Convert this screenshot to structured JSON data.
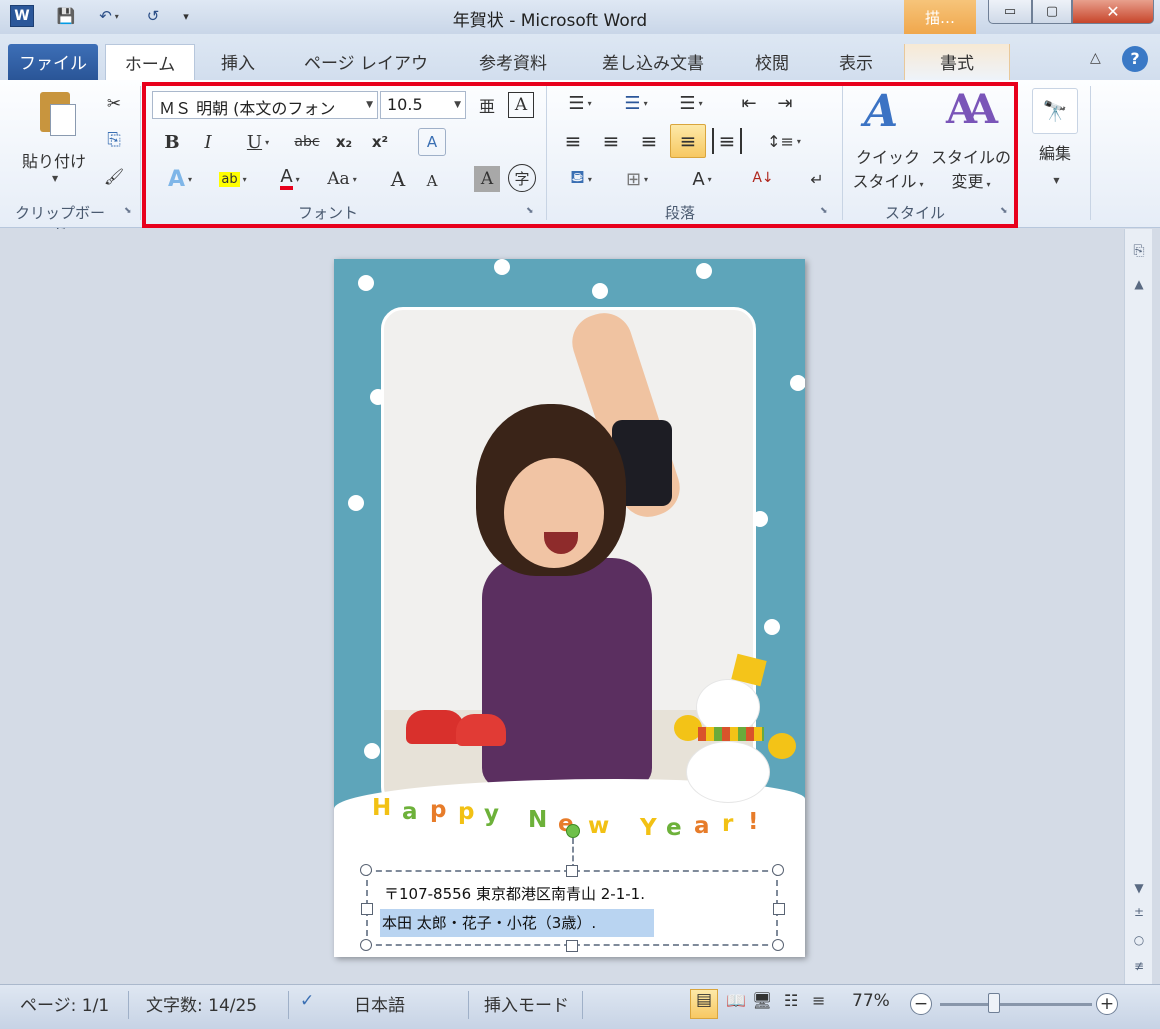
{
  "window": {
    "title": "年賀状 - Microsoft Word",
    "context_tab": "描…",
    "qat": {
      "logo": "W",
      "save": "💾",
      "undo": "↶",
      "redo": "↺",
      "customize": "▾"
    },
    "controls": {
      "minimize": "▭",
      "maximize": "▢",
      "close": "✕"
    }
  },
  "tabs": [
    {
      "label": "ファイル"
    },
    {
      "label": "ホーム"
    },
    {
      "label": "挿入"
    },
    {
      "label": "ページ レイアウト"
    },
    {
      "label": "参考資料"
    },
    {
      "label": "差し込み文書"
    },
    {
      "label": "校閲"
    },
    {
      "label": "表示"
    },
    {
      "label": "書式"
    }
  ],
  "help": {
    "collapse": "△",
    "help": "?"
  },
  "ribbon": {
    "clipboard": {
      "paste": "貼り付け",
      "group": "クリップボード",
      "cut": "✂",
      "copy": "⎘",
      "painter": "🖌"
    },
    "font": {
      "group": "フォント",
      "font_name": "ＭＳ 明朝 (本文のフォン",
      "font_size": "10.5",
      "btn_phonetic": "亜",
      "btn_border": "A",
      "btn_bold": "B",
      "btn_italic": "I",
      "btn_underline": "U",
      "btn_strike": "abc",
      "btn_sub": "x₂",
      "btn_sup": "x²",
      "btn_clear": "A",
      "btn_effect": "A",
      "btn_highlight": "ab",
      "btn_color": "A",
      "btn_case": "Aa",
      "btn_grow": "A",
      "btn_shrink": "A",
      "btn_shade": "A",
      "btn_enclose": "字"
    },
    "paragraph": {
      "group": "段落",
      "bullets": "☰",
      "numbering": "☰",
      "multilevel": "☰",
      "dec_indent": "⇤",
      "inc_indent": "⇥",
      "align_left": "≡",
      "align_center": "≡",
      "align_right": "≡",
      "justify": "≡",
      "distributed": "≡",
      "line_spacing": "↕≡",
      "shading": "⛾",
      "borders": "⊞",
      "asian_layout": "A",
      "sort": "A↓",
      "show_marks": "↵"
    },
    "styles": {
      "group": "スタイル",
      "quick_line1": "クイック",
      "quick_line2": "スタイル",
      "change_line1": "スタイルの",
      "change_line2": "変更"
    },
    "editing": {
      "label": "編集",
      "icon": "🔭"
    }
  },
  "document": {
    "greeting": [
      "H",
      "a",
      "p",
      "p",
      "y",
      "N",
      "e",
      "w",
      "Y",
      "e",
      "a",
      "r",
      "!"
    ],
    "address_line": "〒107-8556 東京都港区南青山 2-1-1.",
    "names_line": "本田 太郎・花子・小花（3歳）.",
    "eol_mark": "↓"
  },
  "scrollbar": {
    "up": "▲",
    "down": "▼",
    "prev": "±",
    "browse": "○",
    "next": "≢"
  },
  "status": {
    "page": "ページ: 1/1",
    "words": "文字数: 14/25",
    "language": "日本語",
    "mode": "挿入モード",
    "zoom": "77%",
    "zoom_minus": "−",
    "zoom_plus": "+"
  },
  "colors": {
    "accent": "#2b579a",
    "highlight_box": "#e8001c",
    "card_bg": "#5ea5ba"
  }
}
